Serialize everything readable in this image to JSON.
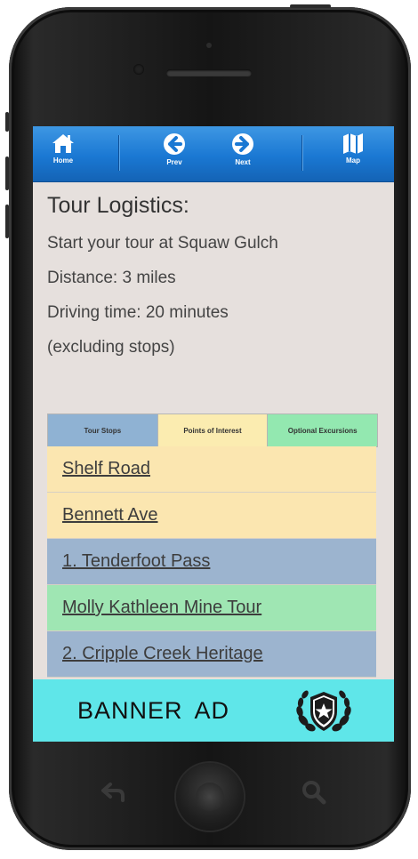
{
  "navbar": {
    "items": [
      {
        "label": "Home",
        "icon": "home-icon"
      },
      {
        "label": "Prev",
        "icon": "arrow-left-icon"
      },
      {
        "label": "Next",
        "icon": "arrow-right-icon"
      },
      {
        "label": "Map",
        "icon": "map-icon"
      }
    ]
  },
  "content": {
    "title": "Tour Logistics:",
    "lines": [
      "Start your tour at Squaw Gulch",
      "Distance: 3 miles",
      "Driving time: 20 minutes",
      "(excluding stops)"
    ]
  },
  "tabs": [
    {
      "label": "Tour Stops",
      "color": "#8fb2d3"
    },
    {
      "label": "Points of Interest",
      "color": "#fbecb0"
    },
    {
      "label": "Optional Excursions",
      "color": "#93e8b0"
    }
  ],
  "list": [
    {
      "label": "Shelf Road",
      "color": "#fbe6b0"
    },
    {
      "label": "Bennett Ave",
      "color": "#fbe6b0"
    },
    {
      "label": "1. Tenderfoot Pass",
      "color": "#9cb4cf"
    },
    {
      "label": "Molly Kathleen Mine Tour",
      "color": "#9fe6b3"
    },
    {
      "label": "2. Cripple Creek Heritage",
      "color": "#9cb4cf"
    }
  ],
  "banner": {
    "text": "BANNER AD",
    "logo_icon": "star-shield-laurel-icon",
    "color": "#5fe6e9"
  },
  "hardware": {
    "back_icon": "back-arrow-icon",
    "search_icon": "search-icon"
  }
}
